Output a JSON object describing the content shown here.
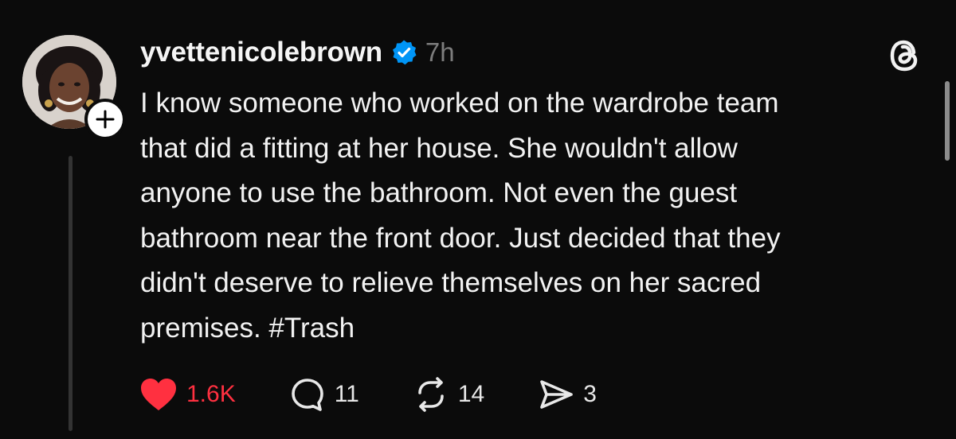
{
  "post": {
    "username": "yvettenicolebrown",
    "verified_icon": "verified-badge-icon",
    "timestamp": "7h",
    "text": "I know someone who worked on the wardrobe team\nthat did a fitting at her house. She wouldn't allow\nanyone to use the bathroom. Not even the guest\nbathroom near the front door. Just decided that they\ndidn't deserve to relieve themselves on her sacred\npremises. #Trash",
    "avatar_icon": "profile-photo",
    "follow_icon": "plus-icon"
  },
  "actions": {
    "like": {
      "icon": "heart-filled-icon",
      "count": "1.6K",
      "liked": true
    },
    "comment": {
      "icon": "comment-bubble-icon",
      "count": "11"
    },
    "repost": {
      "icon": "repost-icon",
      "count": "14"
    },
    "share": {
      "icon": "send-icon",
      "count": "3"
    }
  },
  "app": {
    "logo_icon": "threads-logo-icon"
  },
  "colors": {
    "background": "#0b0b0b",
    "text": "#f2f2f2",
    "muted": "#7d7d7d",
    "like_red": "#ff3040",
    "verified_blue": "#0095f6"
  }
}
